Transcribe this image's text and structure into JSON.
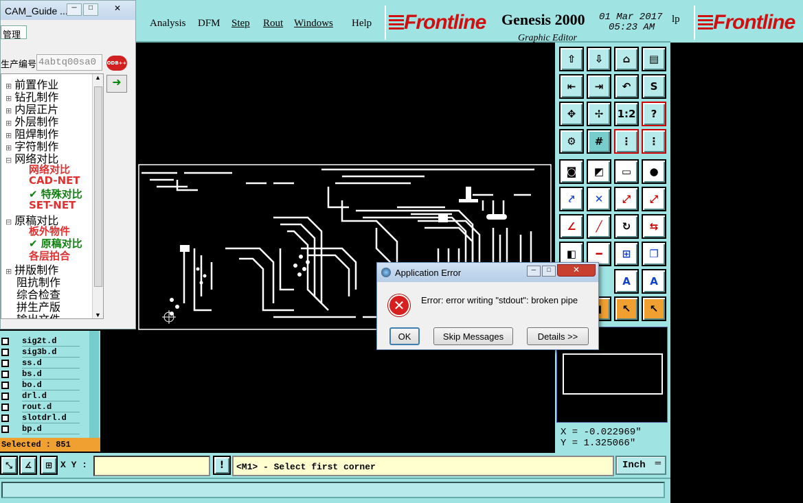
{
  "menu": {
    "items": [
      "Analysis",
      "DFM",
      "Step",
      "Rout",
      "Windows",
      "Help"
    ]
  },
  "header": {
    "logo": "Frontline",
    "app_title": "Genesis 2000",
    "subtitle": "Graphic Editor",
    "date": "01 Mar 2017",
    "time": "05:23 AM",
    "right_logo": "Frontline",
    "right_menu_fragment": "lp"
  },
  "cam_guide": {
    "title": "CAM_Guide ...",
    "tab_label": "管理",
    "job_label": "生产编号",
    "job_value": "4abtq00sa0",
    "odb_icon": "ODB++",
    "tree": [
      {
        "label": "前置作业",
        "expander": "⊞"
      },
      {
        "label": "钻孔制作",
        "expander": "⊞"
      },
      {
        "label": "内层正片",
        "expander": "⊞"
      },
      {
        "label": "外层制作",
        "expander": "⊞"
      },
      {
        "label": "阻焊制作",
        "expander": "⊞"
      },
      {
        "label": "字符制作",
        "expander": "⊞"
      },
      {
        "label": "网络对比",
        "expander": "⊟"
      },
      {
        "label": "网络对比",
        "sub": true,
        "color": "#e03030"
      },
      {
        "label": "CAD-NET",
        "sub": true,
        "color": "#e03030"
      },
      {
        "label": "✔ 特殊对比",
        "sub": true,
        "color": "#108010"
      },
      {
        "label": "SET-NET",
        "sub": true,
        "color": "#e03030"
      },
      {
        "label": "原稿对比",
        "expander": "⊟"
      },
      {
        "label": "板外物件",
        "sub": true,
        "color": "#e03030"
      },
      {
        "label": "✔ 原稿对比",
        "sub": true,
        "color": "#108010"
      },
      {
        "label": "各层拍合",
        "sub": true,
        "color": "#e03030"
      },
      {
        "label": "拼版制作",
        "expander": "⊞"
      },
      {
        "label": "阻抗制作",
        "expander": ""
      },
      {
        "label": "综合检查",
        "expander": ""
      },
      {
        "label": "拼生产版",
        "expander": ""
      },
      {
        "label": "输出文件",
        "expander": ""
      }
    ]
  },
  "layers": [
    "sig2t.d",
    "sig3b.d",
    "ss.d",
    "bs.d",
    "bo.d",
    "drl.d",
    "rout.d",
    "slotdrl.d",
    "bp.d"
  ],
  "selected_text": "Selected : 851",
  "coords": {
    "x": "X = -0.022969\"",
    "y": "Y = 1.325066\""
  },
  "bottom": {
    "xy_label": "X Y :",
    "status": "<M1> - Select first corner",
    "units": "Inch"
  },
  "dialog": {
    "title": "Application Error",
    "message": "Error: error writing \"stdout\": broken pipe",
    "ok": "OK",
    "skip": "Skip Messages",
    "details": "Details >>"
  },
  "colors": {
    "panel": "#9fe3e3",
    "logo_red": "#d01010",
    "orange": "#f0a030",
    "error_red": "#d62020"
  }
}
